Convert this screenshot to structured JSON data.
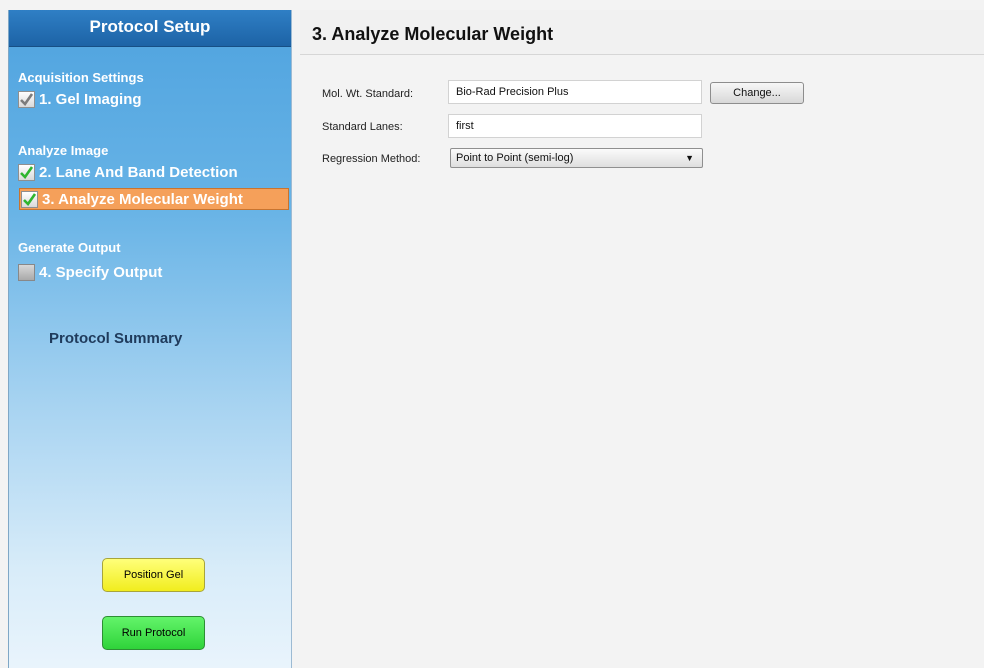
{
  "sidebar": {
    "title": "Protocol Setup",
    "sections": {
      "acquisition": "Acquisition Settings",
      "analyze": "Analyze Image",
      "output": "Generate Output"
    },
    "steps": [
      {
        "label": "1. Gel Imaging",
        "state": "checked-grey"
      },
      {
        "label": "2. Lane And Band Detection",
        "state": "checked"
      },
      {
        "label": "3. Analyze Molecular Weight",
        "state": "checked-active"
      },
      {
        "label": "4. Specify Output",
        "state": "unchecked"
      }
    ],
    "summary_label": "Protocol Summary",
    "buttons": {
      "position_gel": "Position Gel",
      "run_protocol": "Run Protocol"
    }
  },
  "main": {
    "title": "3. Analyze Molecular Weight",
    "fields": {
      "mol_wt_label": "Mol. Wt. Standard:",
      "mol_wt_value": "Bio-Rad Precision Plus",
      "change_button": "Change...",
      "standard_lanes_label": "Standard Lanes:",
      "standard_lanes_value": "first",
      "regression_label": "Regression Method:",
      "regression_value": "Point to Point (semi-log)"
    }
  },
  "colors": {
    "active_step": "#f5a05a",
    "checkmark": "#2fb52f",
    "position_gel_button": "#f1ed1e",
    "run_protocol_button": "#2fd33a"
  }
}
